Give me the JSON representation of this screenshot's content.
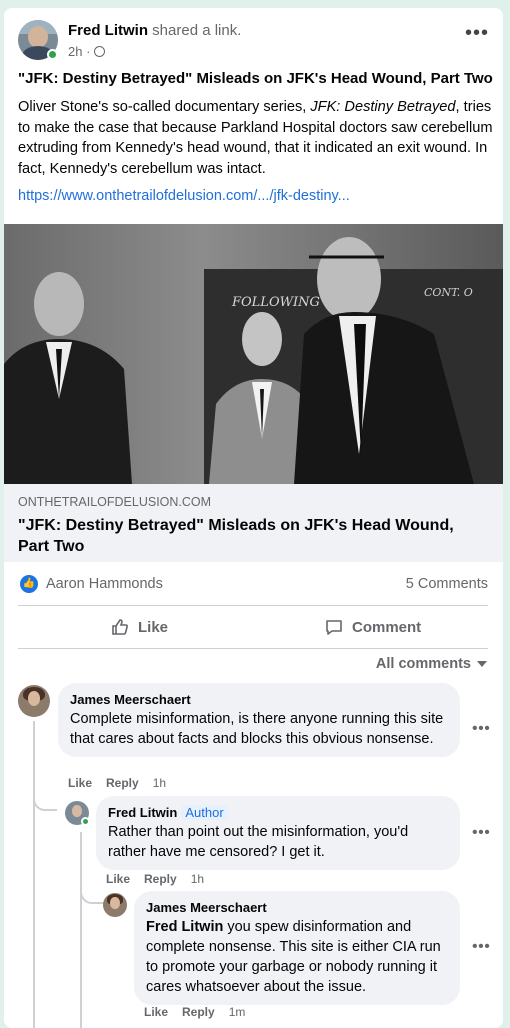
{
  "post": {
    "author": "Fred Litwin",
    "action": "shared a link.",
    "time": "2h ·",
    "title": "\"JFK: Destiny Betrayed\" Misleads on JFK's Head Wound, Part Two",
    "body_pre": "Oliver Stone's so-called documentary series, ",
    "body_italic": "JFK: Destiny Betrayed",
    "body_post": ", tries to make the case that because Parkland Hospital doctors saw cerebellum extruding from Kennedy's head wound, that it indicated an exit wound. In fact, Kennedy's cerebellum was intact.",
    "link_text": "https://www.onthetrailofdelusion.com/.../jfk-destiny..."
  },
  "link_preview": {
    "domain": "ONTHETRAILOFDELUSION.COM",
    "title": "\"JFK: Destiny Betrayed\" Misleads on JFK's Head Wound, Part Two",
    "photo_text1": "FOLLOWING",
    "photo_text2": "CONT. O"
  },
  "reactions": {
    "who": "Aaron Hammonds",
    "comment_count": "5 Comments"
  },
  "actions": {
    "like": "Like",
    "comment": "Comment"
  },
  "filter": "All comments",
  "comments": [
    {
      "name": "James Meerschaert",
      "text": "Complete misinformation, is there anyone running this site that cares about facts and blocks this obvious nonsense.",
      "like": "Like",
      "reply": "Reply",
      "time": "1h"
    },
    {
      "name": "Fred Litwin",
      "badge": "Author",
      "text": "Rather than point out the misinformation, you'd rather have me censored? I get it.",
      "like": "Like",
      "reply": "Reply",
      "time": "1h"
    },
    {
      "name": "James Meerschaert",
      "mention": "Fred Litwin",
      "text": " you spew disinformation and complete nonsense. This site is either CIA run to promote your garbage or nobody running it cares whatsoever about the issue.",
      "like": "Like",
      "reply": "Reply",
      "time": "1m"
    }
  ],
  "colors": {
    "background": "#dff1ea",
    "link": "#216fdb",
    "like_blue": "#1b74e4",
    "online_green": "#31a24c"
  }
}
